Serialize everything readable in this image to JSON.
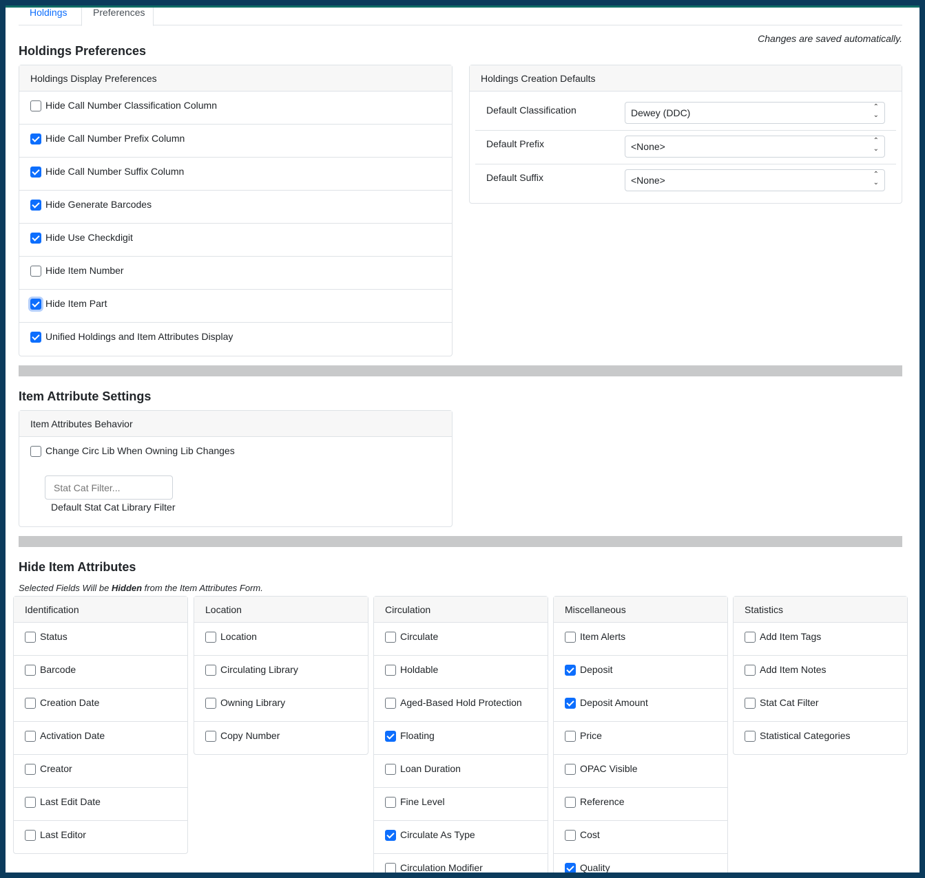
{
  "tabs": [
    "Holdings",
    "Preferences"
  ],
  "autosave_note": "Changes are saved automatically.",
  "holdings_preferences": {
    "title": "Holdings Preferences",
    "display": {
      "header": "Holdings Display Preferences",
      "items": [
        {
          "label": "Hide Call Number Classification Column",
          "checked": false
        },
        {
          "label": "Hide Call Number Prefix Column",
          "checked": true
        },
        {
          "label": "Hide Call Number Suffix Column",
          "checked": true
        },
        {
          "label": "Hide Generate Barcodes",
          "checked": true
        },
        {
          "label": "Hide Use Checkdigit",
          "checked": true
        },
        {
          "label": "Hide Item Number",
          "checked": false
        },
        {
          "label": "Hide Item Part",
          "checked": true,
          "focused": true
        },
        {
          "label": "Unified Holdings and Item Attributes Display",
          "checked": true
        }
      ]
    },
    "creation": {
      "header": "Holdings Creation Defaults",
      "items": [
        {
          "label": "Default Classification",
          "value": "Dewey (DDC)"
        },
        {
          "label": "Default Prefix",
          "value": "<None>"
        },
        {
          "label": "Default Suffix",
          "value": "<None>"
        }
      ]
    }
  },
  "item_attribute_settings": {
    "title": "Item Attribute Settings",
    "header": "Item Attributes Behavior",
    "items": [
      {
        "label": "Change Circ Lib When Owning Lib Changes",
        "checked": false
      }
    ],
    "stat_cat_filter_placeholder": "Stat Cat Filter...",
    "stat_cat_filter_label": "Default Stat Cat Library Filter"
  },
  "hide_item_attributes": {
    "title": "Hide Item Attributes",
    "note_pre": "Selected Fields Will be ",
    "note_bold": "Hidden",
    "note_post": " from the Item Attributes Form.",
    "columns": [
      {
        "header": "Identification",
        "items": [
          {
            "label": "Status",
            "checked": false
          },
          {
            "label": "Barcode",
            "checked": false
          },
          {
            "label": "Creation Date",
            "checked": false
          },
          {
            "label": "Activation Date",
            "checked": false
          },
          {
            "label": "Creator",
            "checked": false
          },
          {
            "label": "Last Edit Date",
            "checked": false
          },
          {
            "label": "Last Editor",
            "checked": false
          }
        ]
      },
      {
        "header": "Location",
        "items": [
          {
            "label": "Location",
            "checked": false
          },
          {
            "label": "Circulating Library",
            "checked": false
          },
          {
            "label": "Owning Library",
            "checked": false
          },
          {
            "label": "Copy Number",
            "checked": false
          }
        ]
      },
      {
        "header": "Circulation",
        "items": [
          {
            "label": "Circulate",
            "checked": false
          },
          {
            "label": "Holdable",
            "checked": false
          },
          {
            "label": "Aged-Based Hold Protection",
            "checked": false
          },
          {
            "label": "Floating",
            "checked": true
          },
          {
            "label": "Loan Duration",
            "checked": false
          },
          {
            "label": "Fine Level",
            "checked": false
          },
          {
            "label": "Circulate As Type",
            "checked": true
          },
          {
            "label": "Circulation Modifier",
            "checked": false
          }
        ]
      },
      {
        "header": "Miscellaneous",
        "items": [
          {
            "label": "Item Alerts",
            "checked": false
          },
          {
            "label": "Deposit",
            "checked": true
          },
          {
            "label": "Deposit Amount",
            "checked": true
          },
          {
            "label": "Price",
            "checked": false
          },
          {
            "label": "OPAC Visible",
            "checked": false
          },
          {
            "label": "Reference",
            "checked": false
          },
          {
            "label": "Cost",
            "checked": false
          },
          {
            "label": "Quality",
            "checked": true
          }
        ]
      },
      {
        "header": "Statistics",
        "items": [
          {
            "label": "Add Item Tags",
            "checked": false
          },
          {
            "label": "Add Item Notes",
            "checked": false
          },
          {
            "label": "Stat Cat Filter",
            "checked": false
          },
          {
            "label": "Statistical Categories",
            "checked": false
          }
        ]
      }
    ]
  }
}
